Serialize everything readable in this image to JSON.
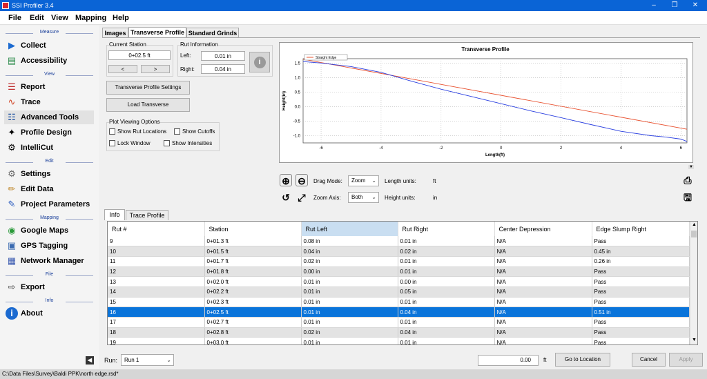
{
  "window": {
    "title": "SSI Profiler 3.4"
  },
  "menu": [
    "File",
    "Edit",
    "View",
    "Mapping",
    "Help"
  ],
  "sidebar": {
    "sections": {
      "measure": "Measure",
      "view": "View",
      "edit": "Edit",
      "mapping": "Mapping",
      "file": "File",
      "info": "Info"
    },
    "items": [
      {
        "label": "Collect",
        "icon": "collect-icon"
      },
      {
        "label": "Accessibility",
        "icon": "accessibility-icon"
      },
      {
        "label": "Report",
        "icon": "report-icon"
      },
      {
        "label": "Trace",
        "icon": "trace-icon"
      },
      {
        "label": "Advanced Tools",
        "icon": "advanced-tools-icon"
      },
      {
        "label": "Profile Design",
        "icon": "profile-design-icon"
      },
      {
        "label": "IntelliCut",
        "icon": "intellicut-icon"
      },
      {
        "label": "Settings",
        "icon": "settings-icon"
      },
      {
        "label": "Edit Data",
        "icon": "edit-data-icon"
      },
      {
        "label": "Project Parameters",
        "icon": "project-parameters-icon"
      },
      {
        "label": "Google Maps",
        "icon": "google-maps-icon"
      },
      {
        "label": "GPS Tagging",
        "icon": "gps-tagging-icon"
      },
      {
        "label": "Network Manager",
        "icon": "network-manager-icon"
      },
      {
        "label": "Export",
        "icon": "export-icon"
      },
      {
        "label": "About",
        "icon": "about-icon"
      }
    ]
  },
  "tabs": [
    "Images",
    "Transverse Profile",
    "Standard Grinds"
  ],
  "station": {
    "title": "Current Station",
    "value": "0+02.5 ft",
    "prev": "<",
    "next": ">"
  },
  "rut": {
    "title": "Rut Information",
    "left_label": "Left:",
    "left_value": "0.01 in",
    "right_label": "Right:",
    "right_value": "0.04 in"
  },
  "buttons": {
    "settings": "Transverse Profile Settings",
    "load": "Load Transverse"
  },
  "plot_options": {
    "title": "Plot Viewing Options",
    "show_rut": "Show Rut Locations",
    "show_cutoffs": "Show Cutoffs",
    "lock_window": "Lock Window",
    "show_intensities": "Show Intensities"
  },
  "chart_data": {
    "type": "line",
    "title": "Transverse Profile",
    "xlabel": "Length(ft)",
    "ylabel": "Height(in)",
    "xlim": [
      -6.6,
      6.2
    ],
    "ylim": [
      -1.25,
      1.65
    ],
    "xticks": [
      -6,
      -4,
      -2,
      0,
      2,
      4,
      6
    ],
    "yticks": [
      1.5,
      1.0,
      0.5,
      0.0,
      -0.5,
      -1.0
    ],
    "ytick_labels": [
      "1.5",
      "1.0",
      "0.5",
      "0.0",
      "-0.5",
      "-1.0"
    ],
    "grid": true,
    "legend": "top-left",
    "series": [
      {
        "name": "Straight Edge",
        "color": "#e8502e",
        "x": [
          -6.6,
          6.2
        ],
        "y": [
          1.63,
          -0.78
        ]
      },
      {
        "name": "",
        "color": "#2a3fe0",
        "x": [
          -6.6,
          -6.0,
          -5.0,
          -4.0,
          -3.0,
          -2.0,
          -1.0,
          0.0,
          1.0,
          2.0,
          3.0,
          4.0,
          5.0,
          5.5,
          6.0,
          6.2
        ],
        "y": [
          1.55,
          1.5,
          1.38,
          1.18,
          0.88,
          0.6,
          0.35,
          0.1,
          -0.15,
          -0.38,
          -0.62,
          -0.85,
          -1.0,
          -1.05,
          -1.12,
          -1.2
        ]
      }
    ]
  },
  "controls": {
    "drag_mode_label": "Drag Mode:",
    "drag_mode_value": "Zoom",
    "zoom_axis_label": "Zoom Axis:",
    "zoom_axis_value": "Both",
    "length_units_label": "Length units:",
    "length_units_value": "ft",
    "height_units_label": "Height units:",
    "height_units_value": "in"
  },
  "subtabs": [
    "Info",
    "Trace Profile"
  ],
  "table": {
    "columns": [
      "Rut #",
      "Station",
      "Rut Left",
      "Rut Right",
      "Center Depression",
      "Edge Slump Right"
    ],
    "rows": [
      [
        "9",
        "0+01.3 ft",
        "0.08 in",
        "0.01 in",
        "N/A",
        "Pass"
      ],
      [
        "10",
        "0+01.5 ft",
        "0.04 in",
        "0.02 in",
        "N/A",
        "0.45 in"
      ],
      [
        "11",
        "0+01.7 ft",
        "0.02 in",
        "0.01 in",
        "N/A",
        "0.26 in"
      ],
      [
        "12",
        "0+01.8 ft",
        "0.00 in",
        "0.01 in",
        "N/A",
        "Pass"
      ],
      [
        "13",
        "0+02.0 ft",
        "0.01 in",
        "0.00 in",
        "N/A",
        "Pass"
      ],
      [
        "14",
        "0+02.2 ft",
        "0.01 in",
        "0.05 in",
        "N/A",
        "Pass"
      ],
      [
        "15",
        "0+02.3 ft",
        "0.01 in",
        "0.01 in",
        "N/A",
        "Pass"
      ],
      [
        "16",
        "0+02.5 ft",
        "0.01 in",
        "0.04 in",
        "N/A",
        "0.51 in"
      ],
      [
        "17",
        "0+02.7 ft",
        "0.01 in",
        "0.01 in",
        "N/A",
        "Pass"
      ],
      [
        "18",
        "0+02.8 ft",
        "0.02 in",
        "0.04 in",
        "N/A",
        "Pass"
      ],
      [
        "19",
        "0+03.0 ft",
        "0.01 in",
        "0.01 in",
        "N/A",
        "Pass"
      ]
    ],
    "selected_row": 7
  },
  "bottom": {
    "run_label": "Run:",
    "run_value": "Run 1",
    "goto_value": "0.00",
    "goto_units": "ft",
    "goto_button": "Go to Location",
    "cancel": "Cancel",
    "apply": "Apply"
  },
  "status": {
    "path": "C:\\Data Files\\Survey\\Baldi PPK\\north edge.rsd*"
  }
}
